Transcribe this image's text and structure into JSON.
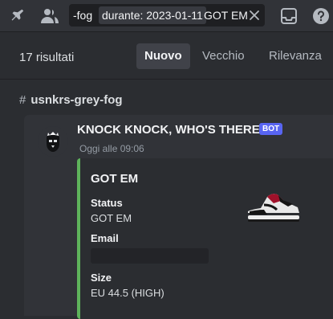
{
  "search": {
    "prefix_text": "-fog",
    "filter_chip": "durante: 2023-01-11",
    "query": "GOT EM"
  },
  "results": {
    "count_label": "17 risultati",
    "sort_tabs": [
      {
        "label": "Nuovo",
        "active": true
      },
      {
        "label": "Vecchio",
        "active": false
      },
      {
        "label": "Rilevanza",
        "active": false
      }
    ]
  },
  "channel": {
    "hash": "#",
    "name": "usnkrs-grey-fog"
  },
  "message": {
    "author": "KNOCK KNOCK, WHO'S THERE?",
    "badge": "BOT",
    "timestamp": "Oggi alle 09:06",
    "embed": {
      "accent_color": "#5eb35b",
      "title": "GOT EM",
      "fields": [
        {
          "name": "Status",
          "value": "GOT EM"
        },
        {
          "name": "Email",
          "value": ""
        },
        {
          "name": "Size",
          "value": "EU 44.5 (HIGH)"
        }
      ]
    }
  },
  "icons": [
    "pin-icon",
    "members-icon",
    "clear-icon",
    "inbox-icon",
    "help-icon"
  ],
  "colors": {
    "bot_badge": "#5865f2",
    "active_tab_bg": "#404249"
  }
}
